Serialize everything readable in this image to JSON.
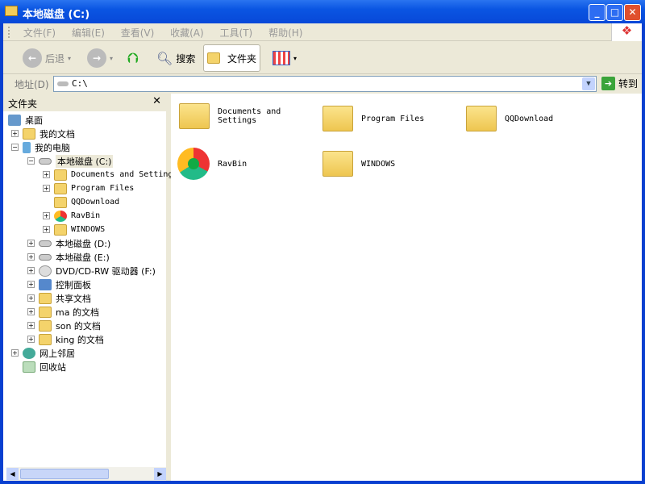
{
  "window": {
    "title": "本地磁盘 (C:)"
  },
  "menu": [
    "文件(F)",
    "编辑(E)",
    "查看(V)",
    "收藏(A)",
    "工具(T)",
    "帮助(H)"
  ],
  "toolbar": {
    "back": "后退",
    "search": "搜索",
    "folders": "文件夹"
  },
  "address": {
    "label": "地址(D)",
    "value": "C:\\",
    "go": "转到"
  },
  "folders_pane": {
    "title": "文件夹",
    "tree": [
      "桌面",
      "我的文档",
      "我的电脑",
      "本地磁盘 (C:)",
      "Documents and Settings",
      "Program Files",
      "QQDownload",
      "RavBin",
      "WINDOWS",
      "本地磁盘 (D:)",
      "本地磁盘 (E:)",
      "DVD/CD-RW 驱动器 (F:)",
      "控制面板",
      "共享文档",
      "ma 的文档",
      "son 的文档",
      "king 的文档",
      "网上邻居",
      "回收站"
    ]
  },
  "content": [
    "Documents and Settings",
    "Program Files",
    "QQDownload",
    "RavBin",
    "WINDOWS"
  ]
}
